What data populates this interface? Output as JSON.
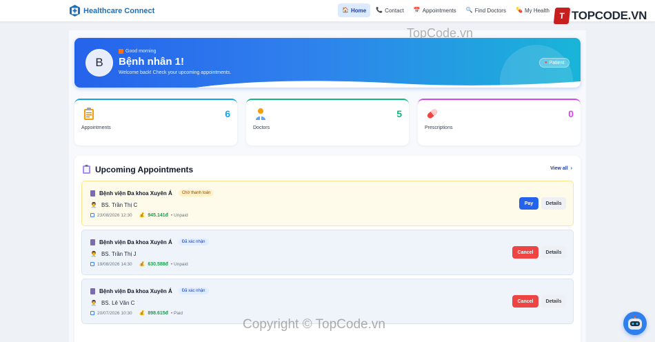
{
  "navbar": {
    "brand": "Healthcare Connect",
    "items": [
      {
        "label": "Home",
        "icon": "home-icon",
        "active": true
      },
      {
        "label": "Contact",
        "icon": "phone-icon",
        "active": false
      },
      {
        "label": "Appointments",
        "icon": "calendar-icon",
        "active": false
      },
      {
        "label": "Find Doctors",
        "icon": "search-icon",
        "active": false
      },
      {
        "label": "My Health",
        "icon": "health-icon",
        "active": false
      }
    ]
  },
  "watermark": {
    "logo_letter": "T",
    "logo_text": "TOPCODE.VN",
    "top_text": "TopCode.vn",
    "bottom_text": "Copyright © TopCode.vn"
  },
  "hero": {
    "avatar_letter": "B",
    "greeting": "Good morning",
    "name": "Bệnh nhân 1!",
    "subtitle": "Welcome back! Check your upcoming appointments.",
    "role": "Patient"
  },
  "stats": [
    {
      "label": "Appointments",
      "value": "6",
      "color": "#0ea5e9",
      "icon": "clipboard-icon"
    },
    {
      "label": "Doctors",
      "value": "5",
      "color": "#10b981",
      "icon": "doctor-icon"
    },
    {
      "label": "Prescriptions",
      "value": "0",
      "color": "#d946ef",
      "icon": "pill-icon"
    }
  ],
  "appointments_section": {
    "title": "Upcoming Appointments",
    "view_all": "View all"
  },
  "appointments": [
    {
      "hospital": "Bệnh viện Đa khoa Xuyên Á",
      "status": "Chờ thanh toán",
      "doctor": "BS. Trần Thị C",
      "datetime": "23/08/2026 12:30",
      "amount": "945.141đ",
      "payment": "• Unpaid",
      "primary_action": "Pay",
      "secondary_action": "Details"
    },
    {
      "hospital": "Bệnh viện Đa khoa Xuyên Á",
      "status": "Đã xác nhận",
      "doctor": "BS. Trần Thị J",
      "datetime": "19/08/2026 14:30",
      "amount": "630.588đ",
      "payment": "• Unpaid",
      "primary_action": "Cancel",
      "secondary_action": "Details"
    },
    {
      "hospital": "Bệnh viện Đa khoa Xuyên Á",
      "status": "Đã xác nhận",
      "doctor": "BS. Lê Văn C",
      "datetime": "20/07/2026 10:30",
      "amount": "898.615đ",
      "payment": "• Paid",
      "primary_action": "Cancel",
      "secondary_action": "Details"
    }
  ],
  "colors": {
    "brand": "#1e6fb8",
    "primary": "#2563eb",
    "danger": "#ef4444",
    "success": "#16a34a"
  }
}
